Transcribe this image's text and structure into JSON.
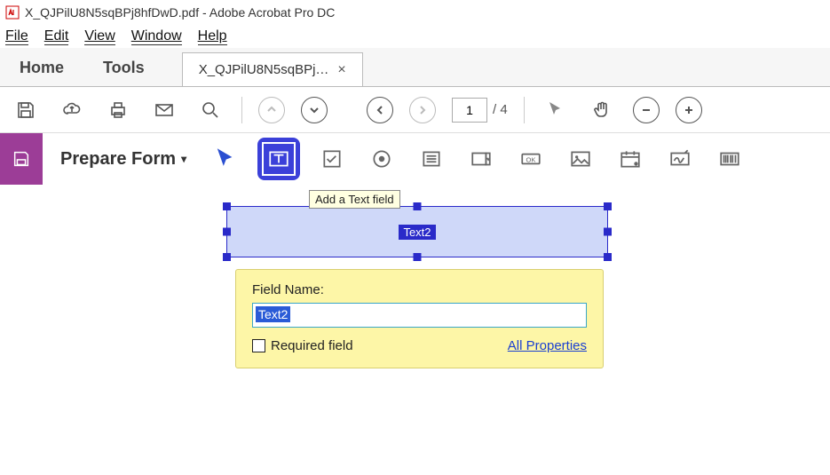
{
  "titlebar": {
    "title": "X_QJPilU8N5sqBPj8hfDwD.pdf - Adobe Acrobat Pro DC"
  },
  "menubar": {
    "file": "File",
    "edit": "Edit",
    "view": "View",
    "window": "Window",
    "help": "Help"
  },
  "tabs": {
    "home": "Home",
    "tools": "Tools",
    "doc": "X_QJPilU8N5sqBPj…",
    "close": "×"
  },
  "page": {
    "current": "1",
    "total": "/ 4"
  },
  "formtoolbar": {
    "title": "Prepare Form",
    "caret": "▾"
  },
  "tooltip": {
    "text": "Add a Text field"
  },
  "field": {
    "label": "Text2"
  },
  "panel": {
    "fieldname_label": "Field Name:",
    "fieldname_value": "Text2",
    "required_label": "Required field",
    "allprops": "All Properties"
  }
}
